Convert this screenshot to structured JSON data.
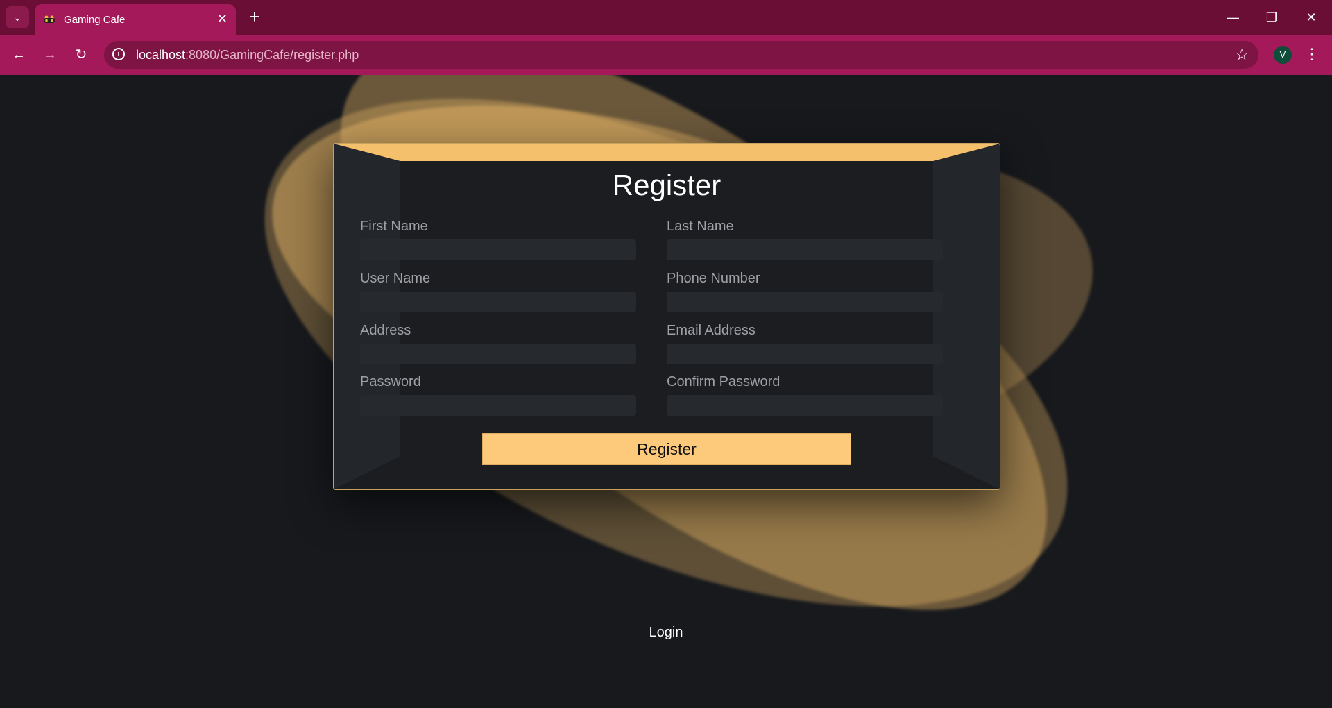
{
  "browser": {
    "tab_title": "Gaming Cafe",
    "url_host": "localhost",
    "url_path": ":8080/GamingCafe/register.php",
    "profile_initial": "V"
  },
  "form": {
    "title": "Register",
    "fields": [
      {
        "label": "First Name",
        "value": ""
      },
      {
        "label": "Last Name",
        "value": ""
      },
      {
        "label": "User Name",
        "value": ""
      },
      {
        "label": "Phone Number",
        "value": ""
      },
      {
        "label": "Address",
        "value": ""
      },
      {
        "label": "Email Address",
        "value": ""
      },
      {
        "label": "Password",
        "value": ""
      },
      {
        "label": "Confirm Password",
        "value": ""
      }
    ],
    "submit_label": "Register"
  },
  "login_link": "Login",
  "colors": {
    "accent": "#fdc97a",
    "background": "#17191d",
    "browser_frame": "#a4195a"
  }
}
